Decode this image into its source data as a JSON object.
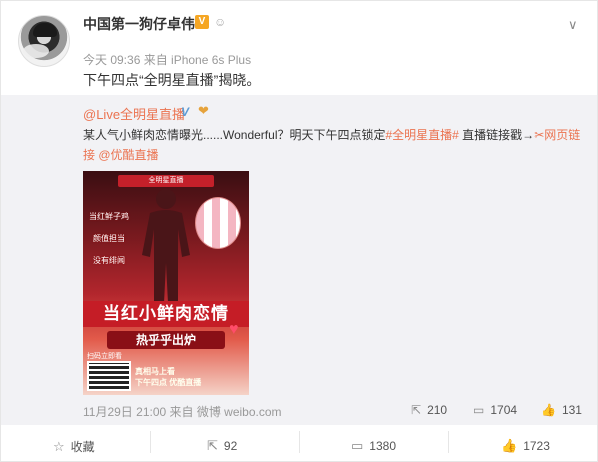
{
  "post": {
    "username": "中国第一狗仔卓伟",
    "v_badge": "V",
    "meta": "今天 09:36 来自 iPhone 6s Plus",
    "text": "下午四点“全明星直播”揭晓。"
  },
  "repost": {
    "author": "@Live全明星直播",
    "v_mark": "V",
    "emoji": "❤",
    "text_prefix": "某人气小鲜肉恋情曝光......Wonderful？明天下午四点锁定",
    "hashtag": "#全明星直播#",
    "text_middle": " 直播链接戳→",
    "weblink_icon": "✂",
    "weblink": "网页链接",
    "mention": " @优酷直播",
    "poster": {
      "banner": "全明星直播",
      "side1": "当红鲜子鸡",
      "side2": "颜值担当",
      "side3": "没有绯闻",
      "title1": "当红小鲜肉恋情",
      "title2": "热乎乎出炉",
      "scan": "扫码立即看",
      "bottom1": "真相马上看",
      "bottom2": "下午四点 优酷直播"
    },
    "time_source": "11月29日 21:00 来自 微博 weibo.com",
    "stats": {
      "repost_count": "210",
      "comment_count": "1704",
      "like_count": "131"
    }
  },
  "actions": {
    "favorite_label": "收藏",
    "repost_count": "92",
    "comment_count": "1380",
    "like_count": "1723"
  },
  "icons": {
    "chevron": "chevron-down-icon",
    "repost": "repost-icon",
    "comment": "comment-icon",
    "like": "thumbs-up-icon",
    "favorite": "star-icon"
  },
  "colors": {
    "link": "#eb7350",
    "repost_bg": "#f2f2f5",
    "badge": "#f5a623"
  }
}
